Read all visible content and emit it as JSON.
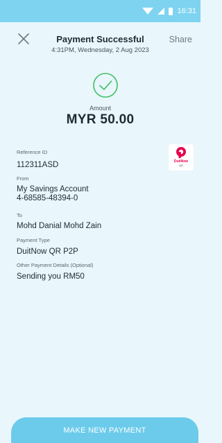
{
  "status_bar": {
    "time": "16:31",
    "icons": [
      "wifi-icon",
      "signal-icon",
      "battery-icon"
    ]
  },
  "header": {
    "title": "Payment Successful",
    "subtitle": "4:31PM, Wednesday, 2 Aug 2023",
    "share_label": "Share",
    "close_icon": "close-icon"
  },
  "status_icon": "check-circle-icon",
  "amount": {
    "label": "Amount",
    "value": "MYR 50.00"
  },
  "details": {
    "reference_label": "Reference ID",
    "reference_value": "112311ASD",
    "from_label": "From",
    "from_account": "My Savings Account",
    "from_number": "4-68585-48394-0",
    "to_label": "To",
    "to_value": "Mohd Danial Mohd Zain",
    "payment_type_label": "Payment Type",
    "payment_type_value": "DuitNow QR P2P",
    "other_label": "Other Payment Details (Optional)",
    "other_value": "Sending you RM50"
  },
  "logo": {
    "name": "DuitNow",
    "sub": "QR"
  },
  "footer": {
    "button_label": "MAKE NEW PAYMENT"
  },
  "colors": {
    "status_bar": "#7dd3f0",
    "background": "#e9f6fb",
    "success_green": "#3fbf63",
    "button": "#6ccbeb",
    "logo_red": "#e6004c"
  }
}
